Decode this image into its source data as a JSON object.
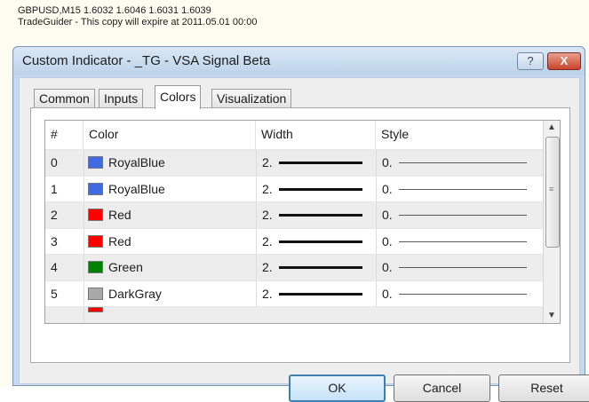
{
  "chart": {
    "symbol_line": "GBPUSD,M15  1.6032 1.6046 1.6031 1.6039",
    "license_line": "TradeGuider - This copy will expire at 2011.05.01 00:00"
  },
  "dialog": {
    "title": "Custom Indicator - _TG - VSA Signal Beta",
    "help_label": "?",
    "close_label": "X"
  },
  "tabs": [
    {
      "label": "Common"
    },
    {
      "label": "Inputs"
    },
    {
      "label": "Colors",
      "active": true
    },
    {
      "label": "Visualization"
    }
  ],
  "table": {
    "headers": {
      "num": "#",
      "color": "Color",
      "width": "Width",
      "style": "Style"
    },
    "rows": [
      {
        "num": "0",
        "color_name": "RoyalBlue",
        "color_hex": "#4169e1",
        "width": "2.",
        "style": "0."
      },
      {
        "num": "1",
        "color_name": "RoyalBlue",
        "color_hex": "#4169e1",
        "width": "2.",
        "style": "0."
      },
      {
        "num": "2",
        "color_name": "Red",
        "color_hex": "#ff0000",
        "width": "2.",
        "style": "0."
      },
      {
        "num": "3",
        "color_name": "Red",
        "color_hex": "#ff0000",
        "width": "2.",
        "style": "0."
      },
      {
        "num": "4",
        "color_name": "Green",
        "color_hex": "#008000",
        "width": "2.",
        "style": "0."
      },
      {
        "num": "5",
        "color_name": "DarkGray",
        "color_hex": "#a9a9a9",
        "width": "2.",
        "style": "0."
      }
    ]
  },
  "buttons": {
    "ok": "OK",
    "cancel": "Cancel",
    "reset": "Reset"
  }
}
